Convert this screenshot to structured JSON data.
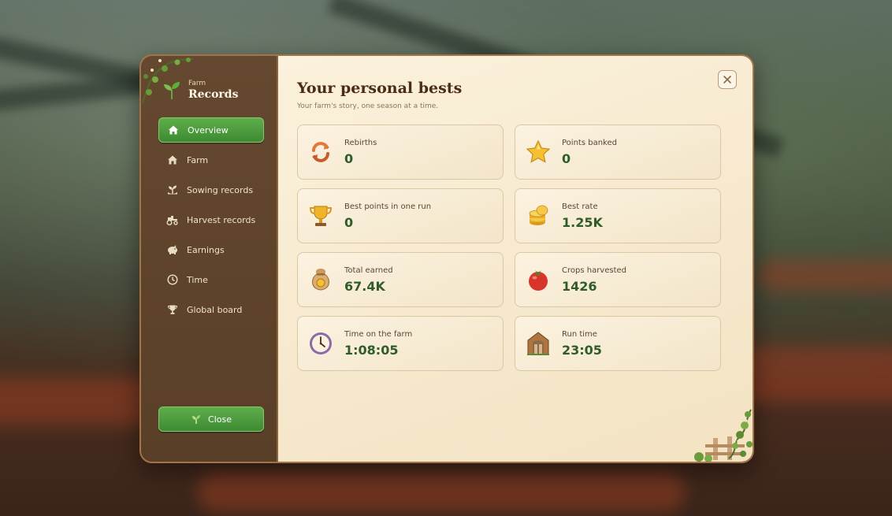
{
  "brand": {
    "small": "Farm",
    "title": "Records"
  },
  "nav": [
    {
      "label": "Overview",
      "icon": "home-icon",
      "active": true
    },
    {
      "label": "Farm",
      "icon": "house-icon",
      "active": false
    },
    {
      "label": "Sowing records",
      "icon": "sprout-icon",
      "active": false
    },
    {
      "label": "Harvest records",
      "icon": "tractor-icon",
      "active": false
    },
    {
      "label": "Earnings",
      "icon": "piggy-bank-icon",
      "active": false
    },
    {
      "label": "Time",
      "icon": "clock-icon",
      "active": false
    },
    {
      "label": "Global board",
      "icon": "trophy-icon",
      "active": false
    }
  ],
  "close_button": {
    "label": "Close",
    "icon": "sprout-icon"
  },
  "header": {
    "title": "Your personal bests",
    "subtitle": "Your farm's story, one season at a time."
  },
  "stats": [
    {
      "label": "Rebirths",
      "value": "0",
      "icon": "rebirth-arrows-icon"
    },
    {
      "label": "Points banked",
      "value": "0",
      "icon": "star-icon"
    },
    {
      "label": "Best points in one run",
      "value": "0",
      "icon": "trophy-cup-icon"
    },
    {
      "label": "Best rate",
      "value": "1.25K",
      "icon": "coin-stack-icon"
    },
    {
      "label": "Total earned",
      "value": "67.4K",
      "icon": "money-bag-icon"
    },
    {
      "label": "Crops harvested",
      "value": "1426",
      "icon": "tomato-icon"
    },
    {
      "label": "Time on the farm",
      "value": "1:08:05",
      "icon": "clock-icon"
    },
    {
      "label": "Run time",
      "value": "23:05",
      "icon": "barn-door-icon"
    }
  ],
  "colors": {
    "accent_green": "#3d8a33",
    "value_green": "#2f5c2a",
    "sidebar_brown": "#5a3f28",
    "panel_cream": "#f6e8cc"
  }
}
